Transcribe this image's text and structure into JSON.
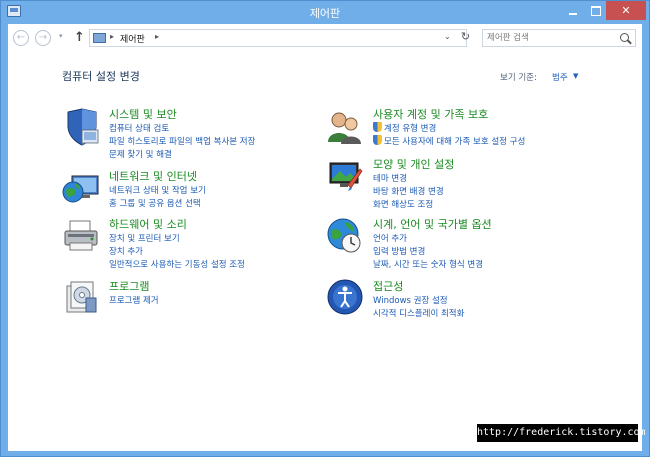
{
  "window": {
    "title": "제어판"
  },
  "navigation": {
    "back_symbol": "←",
    "forward_symbol": "→",
    "recent_symbol": "▾",
    "up_symbol": "↑",
    "address_sep": "▸",
    "address": "제어판",
    "address_dropdown_symbol": "⌄",
    "refresh_symbol": "↻",
    "search_placeholder": "제어판 검색"
  },
  "header": {
    "title": "컴퓨터 설정 변경",
    "view_by_label": "보기 기준:",
    "view_by_value": "범주"
  },
  "categories": [
    {
      "icon": "shield-system-icon",
      "title": "시스템 및 보안",
      "links": [
        "컴퓨터 상태 검토",
        "파일 히스토리로 파일의 백업 복사본 저장",
        "문제 찾기 및 해결"
      ]
    },
    {
      "icon": "network-globe-icon",
      "title": "네트워크 및 인터넷",
      "links": [
        "네트워크 상태 및 작업 보기",
        "홈 그룹 및 공유 옵션 선택"
      ]
    },
    {
      "icon": "printer-hardware-icon",
      "title": "하드웨어 및 소리",
      "links": [
        "장치 및 프린터 보기",
        "장치 추가",
        "일반적으로 사용하는 기동성 설정 조정"
      ]
    },
    {
      "icon": "programs-icon",
      "title": "프로그램",
      "links": [
        "프로그램 제거"
      ]
    },
    {
      "icon": "user-accounts-icon",
      "title": "사용자 계정 및 가족 보호",
      "links": [
        "계정 유형 변경",
        "모든 사용자에 대해 가족 보호 설정 구성"
      ]
    },
    {
      "icon": "personalization-icon",
      "title": "모양 및 개인 설정",
      "links": [
        "테마 변경",
        "바탕 화면 배경 변경",
        "화면 해상도 조정"
      ]
    },
    {
      "icon": "clock-globe-icon",
      "title": "시계, 언어 및 국가별 옵션",
      "links": [
        "언어 추가",
        "입력 방법 변경",
        "날짜, 시간 또는 숫자 형식 변경"
      ]
    },
    {
      "icon": "ease-of-access-icon",
      "title": "접근성",
      "links": [
        "Windows 권장 설정",
        "시각적 디스플레이 최적화"
      ]
    }
  ],
  "watermark": "http://frederick.tistory.com",
  "colors": {
    "title_bar": "#6faee8",
    "category_title": "#1a8a21",
    "link": "#1c5bb5",
    "close_button": "#c75050"
  }
}
